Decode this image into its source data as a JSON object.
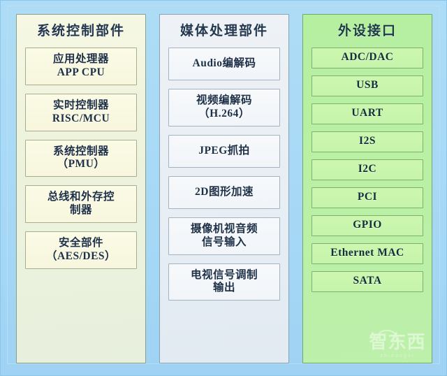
{
  "diagram": {
    "background_color": "#a9daf6",
    "columns": [
      {
        "id": "system-control",
        "title": "系统控制部件",
        "panel_color": "#eef3dd",
        "blocks": [
          {
            "lines": [
              "应用处理器",
              "APP CPU"
            ]
          },
          {
            "lines": [
              "实时控制器",
              "RISC/MCU"
            ]
          },
          {
            "lines": [
              "系统控制器",
              "（PMU）"
            ]
          },
          {
            "lines": [
              "总线和外存控",
              "制器"
            ]
          },
          {
            "lines": [
              "安全部件",
              "（AES/DES）"
            ]
          }
        ]
      },
      {
        "id": "media-processing",
        "title": "媒体处理部件",
        "panel_color": "#e8eef4",
        "blocks": [
          {
            "lines": [
              "Audio编解码"
            ]
          },
          {
            "lines": [
              "视频编解码",
              "（H.264）"
            ]
          },
          {
            "lines": [
              "JPEG抓拍"
            ]
          },
          {
            "lines": [
              "2D图形加速"
            ]
          },
          {
            "lines": [
              "摄像机视音频",
              "信号输入"
            ]
          },
          {
            "lines": [
              "电视信号调制",
              "输出"
            ]
          }
        ]
      },
      {
        "id": "peripheral-interface",
        "title": "外设接口",
        "panel_color": "#bbf0a6",
        "blocks": [
          {
            "lines": [
              "ADC/DAC"
            ]
          },
          {
            "lines": [
              "USB"
            ]
          },
          {
            "lines": [
              "UART"
            ]
          },
          {
            "lines": [
              "I2S"
            ]
          },
          {
            "lines": [
              "I2C"
            ]
          },
          {
            "lines": [
              "PCI"
            ]
          },
          {
            "lines": [
              "GPIO"
            ]
          },
          {
            "lines": [
              "Ethernet MAC"
            ]
          },
          {
            "lines": [
              "SATA"
            ]
          }
        ]
      }
    ]
  },
  "watermark": {
    "main": "智东西",
    "sub": "zhidongxi"
  }
}
